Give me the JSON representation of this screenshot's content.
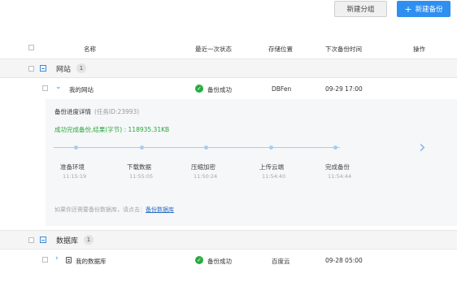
{
  "toolbar": {
    "new_group_label": "新建分组",
    "new_backup_label": "新建备份"
  },
  "table": {
    "columns": {
      "name": "名称",
      "last_status": "最近一次状态",
      "storage": "存储位置",
      "next_backup": "下次备份时间",
      "actions": "操作"
    }
  },
  "groups": [
    {
      "name": "网站",
      "count": "1",
      "item": {
        "name": "我的网站",
        "status": "备份成功",
        "storage": "DBFen",
        "next_backup": "09-29 17:00"
      },
      "detail": {
        "title": "备份进度详情",
        "task_id": "(任务ID:23993)",
        "success_text": "成功完成备份,结果(字节) : 118935.31KB",
        "steps": [
          {
            "label": "准备环境",
            "time": "11:15:19"
          },
          {
            "label": "下载数据",
            "time": "11:55:05"
          },
          {
            "label": "压缩加密",
            "time": "11:50:24"
          },
          {
            "label": "上传云端",
            "time": "11:54:40"
          },
          {
            "label": "完成备份",
            "time": "11:54:44"
          }
        ],
        "hint_prefix": "如果你还需要备份数据库，请点击：",
        "hint_link": "备份数据库"
      }
    },
    {
      "name": "数据库",
      "count": "1",
      "item": {
        "name": "我的数据库",
        "status": "备份成功",
        "storage": "百度云",
        "next_backup": "09-28 05:00"
      }
    }
  ],
  "colors": {
    "accent": "#2e8ff0",
    "success": "#27ad3f",
    "timeline": "#a9cdef"
  }
}
